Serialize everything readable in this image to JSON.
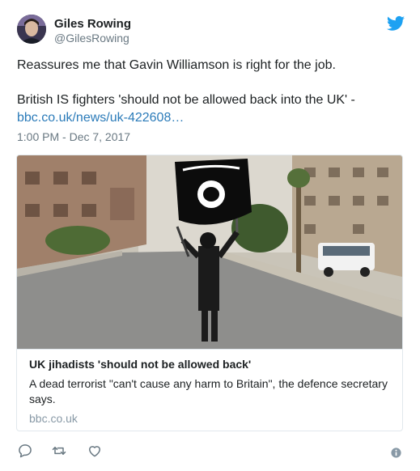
{
  "author": {
    "name": "Giles Rowing",
    "handle": "@GilesRowing"
  },
  "tweet": {
    "line1": "Reassures me that Gavin Williamson is right for the job.",
    "line2": "British IS fighters 'should not be allowed back into the UK' -",
    "link": "bbc.co.uk/news/uk-422608…",
    "timestamp": "1:00 PM - Dec 7, 2017"
  },
  "card": {
    "title": "UK jihadists 'should not be allowed back'",
    "description": "A dead terrorist \"can't cause any harm to Britain\", the defence secretary says.",
    "domain": "bbc.co.uk"
  },
  "icons": {
    "platform": "twitter-bird-icon",
    "actions": [
      "reply-icon",
      "retweet-icon",
      "like-icon"
    ],
    "info": "info-icon"
  },
  "colors": {
    "link": "#2b7bb9",
    "brand": "#1da1f2",
    "muted": "#697882",
    "border": "#e1e8ed"
  }
}
